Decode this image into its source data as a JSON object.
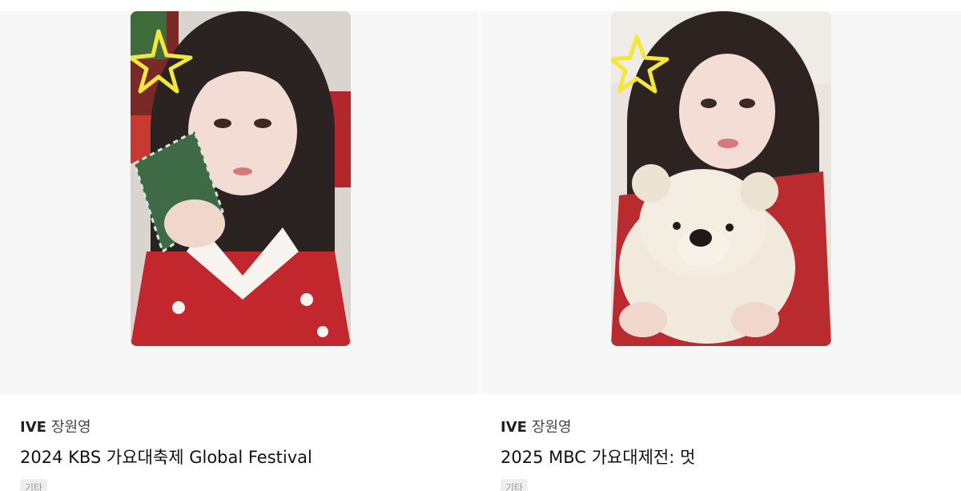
{
  "products": [
    {
      "group": "IVE",
      "member": "장원영",
      "title": "2024 KBS 가요대축제 Global Festival",
      "tag": "기타",
      "image_alt": "IVE Jang Wonyoung photocard, Christmas outfit"
    },
    {
      "group": "IVE",
      "member": "장원영",
      "title": "2025 MBC 가요대제전: 멋",
      "tag": "기타",
      "image_alt": "IVE Jang Wonyoung photocard holding teddy bear"
    }
  ],
  "colors": {
    "image_bg": "#f7f7f7",
    "tag_bg": "#eeeeee",
    "tag_text": "#999999",
    "title_text": "#111111"
  }
}
